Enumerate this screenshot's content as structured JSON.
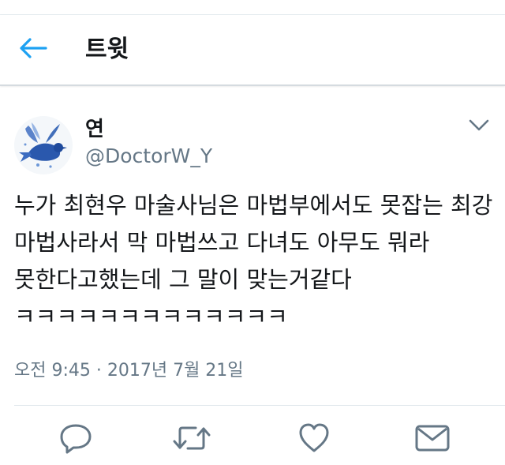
{
  "header": {
    "title": "트윗",
    "back_icon": "arrow-left-icon",
    "accent_color": "#1da1f2"
  },
  "tweet": {
    "display_name": "연",
    "handle": "@DoctorW_Y",
    "avatar_icon": "blue-bird-avatar",
    "more_icon": "chevron-down-icon",
    "text": "누가 최현우 마술사님은 마법부에서도 못잡는 최강 마법사라서 막 마법쓰고 다녀도 아무도 뭐라 못한다고했는데 그 말이 맞는거같다 ㅋㅋㅋㅋㅋㅋㅋㅋㅋㅋㅋㅋㅋ",
    "timestamp": "오전 9:45 · 2017년 7월 21일"
  },
  "actions": [
    {
      "name": "reply",
      "icon": "reply-icon"
    },
    {
      "name": "retweet",
      "icon": "retweet-icon"
    },
    {
      "name": "like",
      "icon": "heart-icon"
    },
    {
      "name": "message",
      "icon": "envelope-icon"
    }
  ],
  "colors": {
    "icon_gray": "#657786",
    "text": "#14171a"
  }
}
